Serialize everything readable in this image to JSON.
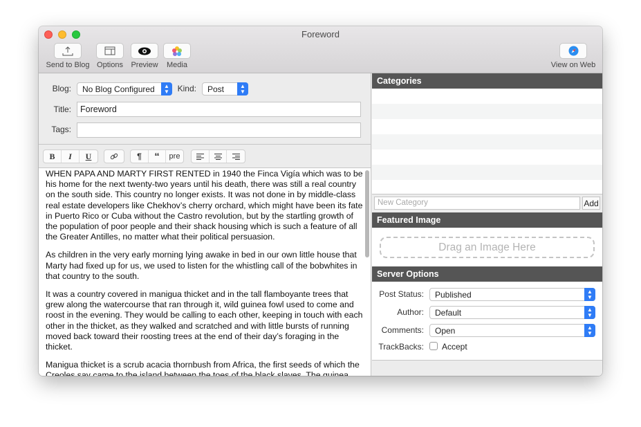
{
  "window": {
    "title": "Foreword"
  },
  "toolbar": {
    "send": "Send to Blog",
    "options": "Options",
    "preview": "Preview",
    "media": "Media",
    "view_web": "View on Web"
  },
  "form": {
    "blog_label": "Blog:",
    "blog_value": "No Blog Configured",
    "kind_label": "Kind:",
    "kind_value": "Post",
    "title_label": "Title:",
    "title_value": "Foreword",
    "tags_label": "Tags:",
    "tags_value": ""
  },
  "format": {
    "bold": "B",
    "italic": "I",
    "underline": "U",
    "paragraph": "¶",
    "quote": "“",
    "pre": "pre"
  },
  "body": {
    "paragraphs": [
      "WHEN PAPA AND MARTY FIRST RENTED in 1940 the Finca Vigía which was to be his home for the next twenty-two years until his death, there was still a real country on the south side. This country no longer exists. It was not done in by middle-class real estate developers like Chekhov’s cherry orchard, which might have been its fate in Puerto Rico or Cuba without the Castro revolution, but by the startling growth of the population of poor people and their shack housing which is such a feature of all the Greater Antilles, no matter what their political persuasion.",
      "As children in the very early morning lying awake in bed in our own little house that Marty had fixed up for us, we used to listen for the whistling call of the bobwhites in that country to the south.",
      "It was a country covered in manigua thicket and in the tall flamboyante trees that grew along the watercourse that ran through it, wild guinea fowl used to come and roost in the evening. They would be calling to each other, keeping in touch with each other in the thicket, as they walked and scratched and with little bursts of running moved back toward their roosting trees at the end of their day’s foraging in the thicket.",
      "Manigua thicket is a scrub acacia thornbush from Africa, the first seeds of which the Creoles say came to the island between the toes of the black slaves. The guinea fowl"
    ]
  },
  "categories": {
    "header": "Categories",
    "new_placeholder": "New Category",
    "add": "Add"
  },
  "featured": {
    "header": "Featured Image",
    "drop": "Drag an Image Here"
  },
  "server": {
    "header": "Server Options",
    "status_label": "Post Status:",
    "status_value": "Published",
    "author_label": "Author:",
    "author_value": "Default",
    "comments_label": "Comments:",
    "comments_value": "Open",
    "trackbacks_label": "TrackBacks:",
    "accept": "Accept",
    "accept_checked": false
  },
  "colors": {
    "accent": "#2f7cf6",
    "section_header": "#555555"
  }
}
